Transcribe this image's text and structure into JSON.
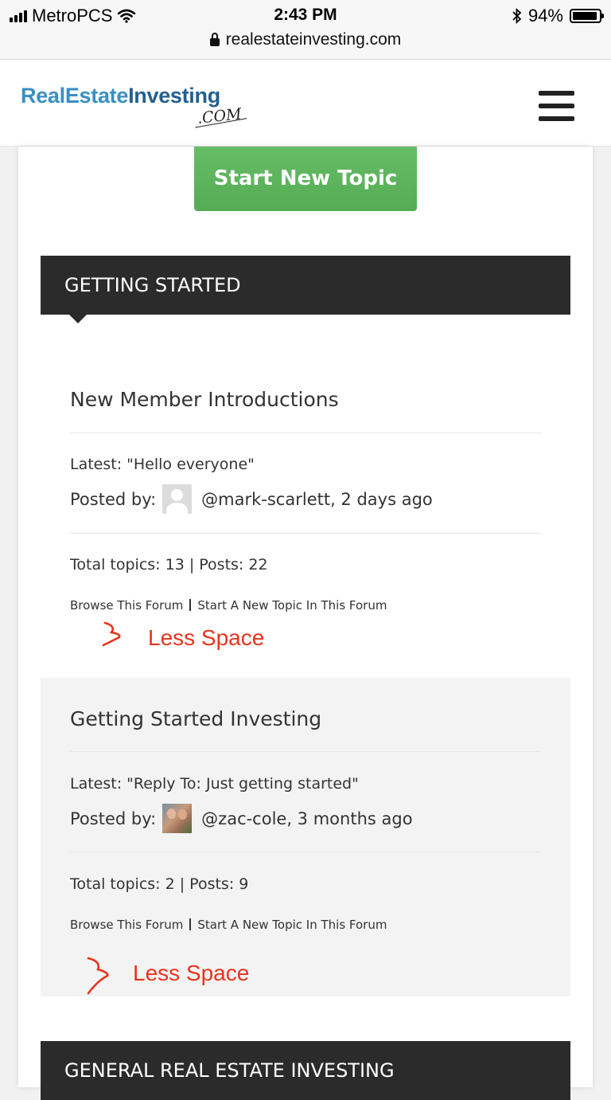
{
  "status_bar": {
    "carrier": "MetroPCS",
    "time": "2:43 PM",
    "battery_text": "94%",
    "battery_level": 0.94
  },
  "browser": {
    "url": "realestateinvesting.com"
  },
  "header": {
    "logo_part1": "RealEstate",
    "logo_part2": "Investing",
    "logo_com": ".COM"
  },
  "start_button": "Start New Topic",
  "sections": [
    {
      "title": "GETTING STARTED"
    },
    {
      "title": "GENERAL REAL ESTATE INVESTING"
    }
  ],
  "forums": [
    {
      "title": "New Member Introductions",
      "latest": "Latest: \"Hello everyone\"",
      "posted_label": "Posted by:",
      "posted_by": "@mark-scarlett, 2 days ago",
      "totals": "Total topics: 13 | Posts: 22",
      "browse_link": "Browse This Forum",
      "new_topic_link": "Start A New Topic In This Forum",
      "annotation": "Less Space"
    },
    {
      "title": "Getting Started Investing",
      "latest": "Latest: \"Reply To: Just getting started\"",
      "posted_label": "Posted by:",
      "posted_by": "@zac-cole, 3 months ago",
      "totals": "Total topics: 2 | Posts: 9",
      "browse_link": "Browse This Forum",
      "new_topic_link": "Start A New Topic In This Forum",
      "annotation": "Less Space"
    }
  ],
  "colors": {
    "start_button": "#5cb85c",
    "section_header": "#2b2b2b",
    "annotation": "#e8341c",
    "logo_light": "#3a8fc4",
    "logo_dark": "#245e8f"
  }
}
